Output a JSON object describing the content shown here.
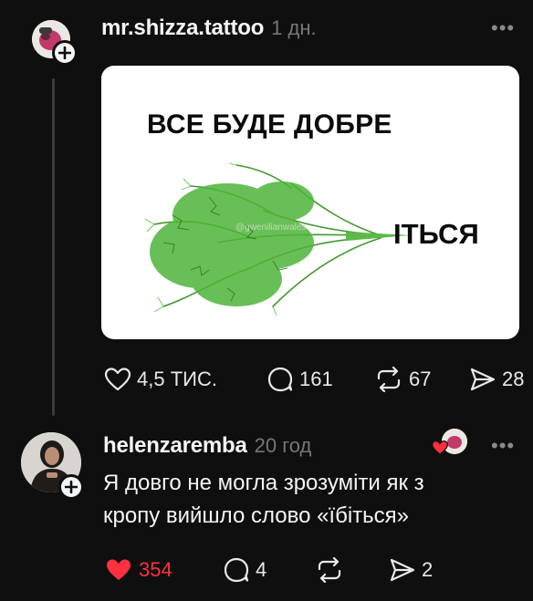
{
  "post": {
    "username": "mr.shizza.tattoo",
    "time": "1 дн.",
    "more": "•••",
    "image": {
      "title": "ВСЕ БУДЕ ДОБРЕ",
      "suffix": "ІТЬСЯ",
      "watermark": "@gwenilianwales"
    },
    "actions": {
      "likes": "4,5 ТИС.",
      "comments": "161",
      "reposts": "67",
      "shares": "28"
    }
  },
  "reply": {
    "username": "helenzaremba",
    "time": "20 год",
    "more": "•••",
    "text_line1": "Я довго не могла зрозуміти як з",
    "text_line2": "кропу вийшло слово «їбіться»",
    "actions": {
      "likes": "354",
      "comments": "4",
      "shares": "2"
    }
  },
  "colors": {
    "background": "#0f0f0f",
    "liked": "#ff3040",
    "muted": "#777777"
  }
}
